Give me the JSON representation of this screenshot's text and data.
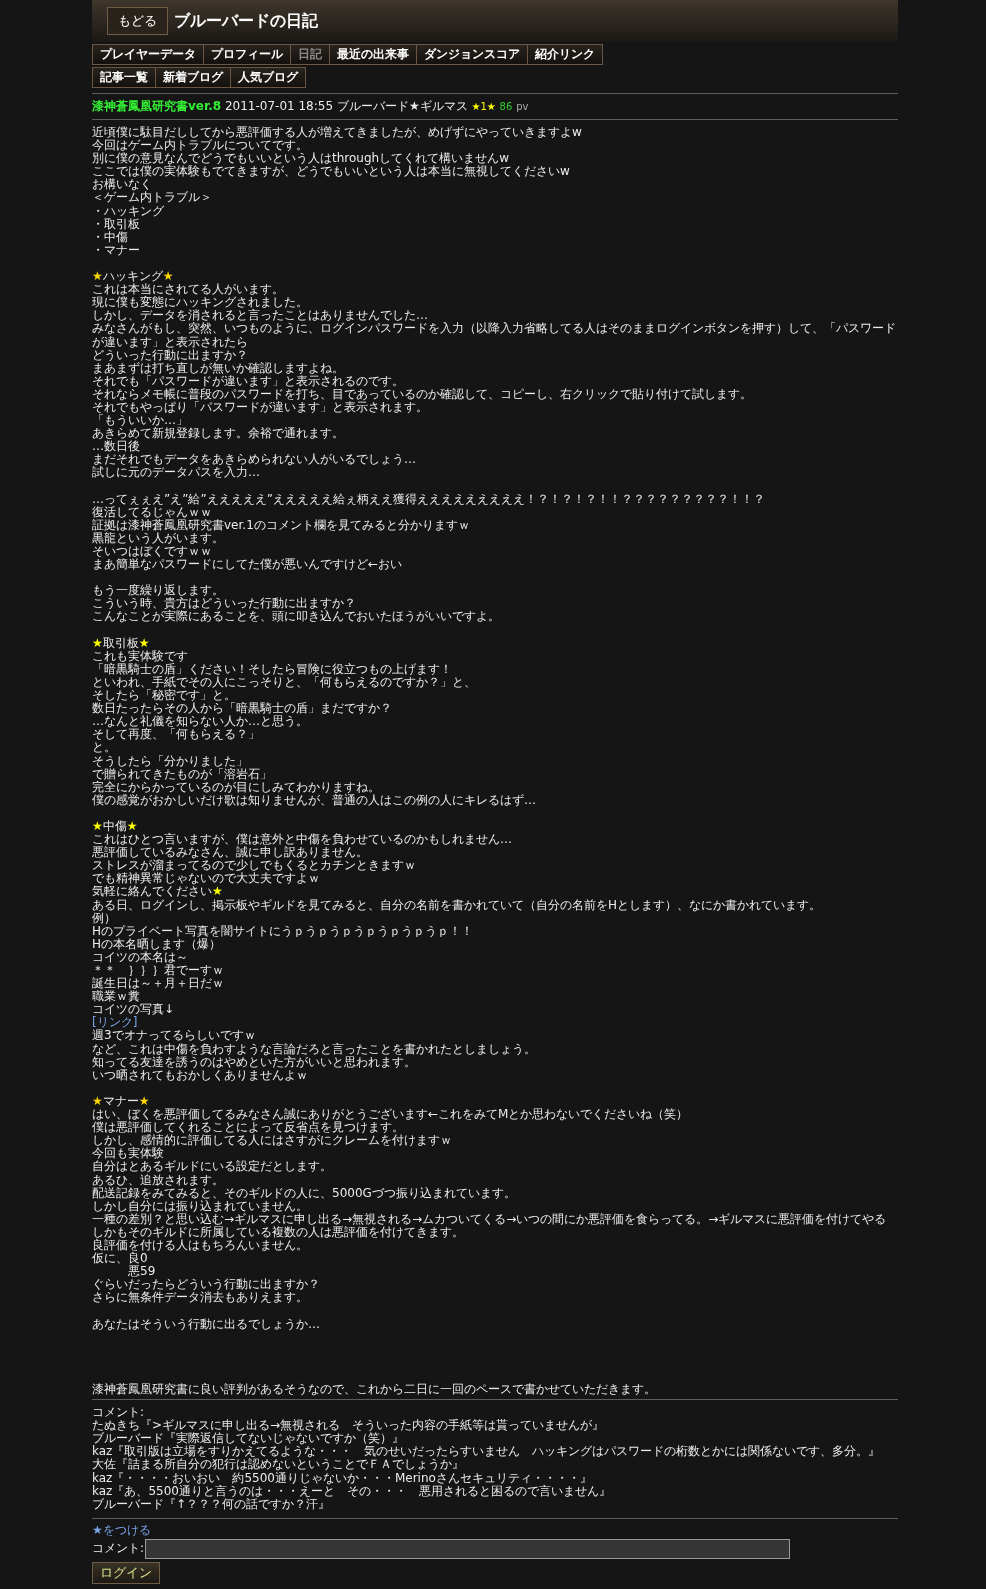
{
  "header": {
    "back_button": "もどる",
    "title": "ブルーバードの日記"
  },
  "tab_rows": [
    {
      "tabs": [
        {
          "label": "プレイヤーデータ",
          "selected": false
        },
        {
          "label": "プロフィール",
          "selected": false
        },
        {
          "label": "日記",
          "selected": true
        },
        {
          "label": "最近の出来事",
          "selected": false
        },
        {
          "label": "ダンジョンスコア",
          "selected": false
        },
        {
          "label": "紹介リンク",
          "selected": false
        }
      ]
    },
    {
      "tabs": [
        {
          "label": "記事一覧",
          "selected": false
        },
        {
          "label": "新着ブログ",
          "selected": false
        },
        {
          "label": "人気ブログ",
          "selected": false
        }
      ]
    }
  ],
  "entry": {
    "title": "漆神蒼鳳凰研究書ver.8",
    "date": "2011-07-01 18:55",
    "author": "ブルーバード★ギルマス",
    "rating": "★1★",
    "views": "86",
    "views_unit": "pv"
  },
  "article": {
    "lines": [
      {
        "text": "近頃僕に駄目だししてから悪評価する人が増えてきましたが、めげずにやっていきますよw"
      },
      {
        "text": "今回はゲーム内トラブルについてです。"
      },
      {
        "text": "別に僕の意見なんでどうでもいいという人はthroughしてくれて構いませんw"
      },
      {
        "text": "ここでは僕の実体験もでてきますが、どうでもいいという人は本当に無視してくださいw"
      },
      {
        "text": "お構いなく"
      },
      {
        "text": "＜ゲーム内トラブル＞"
      },
      {
        "text": "・ハッキング"
      },
      {
        "text": "・取引板"
      },
      {
        "text": "・中傷"
      },
      {
        "text": "・マナー"
      },
      {
        "kind": "blank"
      },
      {
        "parts": [
          {
            "text": "★",
            "color": "#ffd700"
          },
          {
            "text": "ハッキング"
          },
          {
            "text": "★",
            "color": "#ffd700"
          }
        ]
      },
      {
        "text": "これは本当にされてる人がいます。"
      },
      {
        "text": "現に僕も変態にハッキングされました。"
      },
      {
        "text": "しかし、データを消されると言ったことはありませんでした…"
      },
      {
        "text": "みなさんがもし、突然、いつものように、ログインパスワードを入力（以降入力省略してる人はそのままログインボタンを押す）して、「パスワードが違います」と表示されたら"
      },
      {
        "text": "どういった行動に出ますか？"
      },
      {
        "text": "まあまずは打ち直しが無いか確認しますよね。"
      },
      {
        "text": "それでも「パスワードが違います」と表示されるのです。"
      },
      {
        "text": "それならメモ帳に普段のパスワードを打ち、目であっているのか確認して、コピーし、右クリックで貼り付けて試します。"
      },
      {
        "text": "それでもやっぱり「パスワードが違います」と表示されます。"
      },
      {
        "text": "「もういいか…」"
      },
      {
        "text": "あきらめて新規登録します。余裕で通れます。"
      },
      {
        "text": "…数日後"
      },
      {
        "text": "まだそれでもデータをあきらめられない人がいるでしょう…"
      },
      {
        "text": "試しに元のデータパスを入力…"
      },
      {
        "kind": "blank"
      },
      {
        "text": "…ってぇぇえ”え”給”えええええ”えええええ給ぇ柄ええ獲得えええええええええ！？！？！？！！？？？？？？？？？！！？"
      },
      {
        "text": "復活してるじゃんｗｗ"
      },
      {
        "text": "証拠は漆神蒼鳳凰研究書ver.1のコメント欄を見てみると分かりますｗ"
      },
      {
        "text": "黒龍という人がいます。"
      },
      {
        "text": "そいつはぼくですｗｗ"
      },
      {
        "text": "まあ簡単なパスワードにしてた僕が悪いんですけど←おい"
      },
      {
        "kind": "blank"
      },
      {
        "text": "もう一度繰り返します。"
      },
      {
        "text": "こういう時、貴方はどういった行動に出ますか？"
      },
      {
        "text": "こんなことが実際にあることを、頭に叩き込んでおいたほうがいいですよ。"
      },
      {
        "kind": "blank"
      },
      {
        "parts": [
          {
            "text": "★",
            "color": "#ffff00"
          },
          {
            "text": "取引板"
          },
          {
            "text": "★",
            "color": "#ffff00"
          }
        ]
      },
      {
        "text": "これも実体験です"
      },
      {
        "text": "「暗黒騎士の盾」ください！そしたら冒険に役立つもの上げます！"
      },
      {
        "text": "といわれ、手紙でその人にこっそりと、「何もらえるのですか？」と、"
      },
      {
        "text": "そしたら「秘密です」と。"
      },
      {
        "text": "数日たったらその人から「暗黒騎士の盾」まだですか？"
      },
      {
        "text": "…なんと礼儀を知らない人か…と思う。"
      },
      {
        "text": "そして再度、「何もらえる？」"
      },
      {
        "text": "と。"
      },
      {
        "text": "そうしたら「分かりました」"
      },
      {
        "text": "で贈られてきたものが「溶岩石」"
      },
      {
        "text": "完全にからかっているのが目にしみてわかりますね。"
      },
      {
        "text": "僕の感覚がおかしいだけ歌は知りませんが、普通の人はこの例の人にキレるはず…"
      },
      {
        "kind": "blank"
      },
      {
        "parts": [
          {
            "text": "★",
            "color": "#ffff00"
          },
          {
            "text": "中傷"
          },
          {
            "text": "★",
            "color": "#ffff00"
          }
        ]
      },
      {
        "text": "これはひとつ言いますが、僕は意外と中傷を負わせているのかもしれません…"
      },
      {
        "text": "悪評価しているみなさん、誠に申し訳ありません。"
      },
      {
        "text": "ストレスが溜まってるので少しでもくるとカチンときますｗ"
      },
      {
        "text": "でも精神異常じゃないので大丈夫ですよｗ"
      },
      {
        "parts": [
          {
            "text": "気軽に絡んでください"
          },
          {
            "text": "★",
            "color": "#ffff00"
          }
        ]
      },
      {
        "text": "ある日、ログインし、掲示板やギルドを見てみると、自分の名前を書かれていて（自分の名前をHとします）、なにか書かれています。"
      },
      {
        "text": "例）"
      },
      {
        "text": "Hのプライベート写真を闇サイトにうｐうｐうｐうｐうｐうｐうｐ！！"
      },
      {
        "text": "Hの本名晒します（爆）"
      },
      {
        "text": "コイツの本名は～"
      },
      {
        "text": "＊＊　｝｝｝君でーすｗ"
      },
      {
        "text": "誕生日は～＋月＋日だｗ"
      },
      {
        "text": "職業ｗ糞"
      },
      {
        "text": "コイツの写真↓"
      },
      {
        "kind": "link",
        "text": "[リンク]"
      },
      {
        "text": "週3でオナってるらしいですｗ"
      },
      {
        "text": "など、これは中傷を負わすような言論だろと言ったことを書かれたとしましょう。"
      },
      {
        "text": "知ってる友達を誘うのはやめといた方がいいと思われます。"
      },
      {
        "text": "いつ晒されてもおかしくありませんよｗ"
      },
      {
        "kind": "blank"
      },
      {
        "parts": [
          {
            "text": "★",
            "color": "#ffd700"
          },
          {
            "text": "マナー"
          },
          {
            "text": "★",
            "color": "#ffd700"
          }
        ]
      },
      {
        "text": "はい、ぼくを悪評価してるみなさん誠にありがとうございます←これをみてMとか思わないでくださいね（笑）"
      },
      {
        "text": "僕は悪評価してくれることによって反省点を見つけます。"
      },
      {
        "text": "しかし、感情的に評価してる人にはさすがにクレームを付けますｗ"
      },
      {
        "text": "今回も実体験"
      },
      {
        "text": "自分はとあるギルドにいる設定だとします。"
      },
      {
        "text": "あるひ、追放されます。"
      },
      {
        "text": "配送記録をみてみると、そのギルドの人に、5000Gづつ振り込まれています。"
      },
      {
        "text": "しかし自分には振り込まれていません。"
      },
      {
        "text": "一種の差別？と思い込む→ギルマスに申し出る→無視される→ムカついてくる→いつの間にか悪評価を食らってる。→ギルマスに悪評価を付けてやる"
      },
      {
        "text": "しかもそのギルドに所属している複数の人は悪評価を付けてきます。"
      },
      {
        "text": "良評価を付ける人はもちろんいません。"
      },
      {
        "text": "仮に、良0"
      },
      {
        "text": "　　　悪59"
      },
      {
        "text": "ぐらいだったらどういう行動に出ますか？"
      },
      {
        "text": "さらに無条件データ消去もありえます。"
      },
      {
        "kind": "blank"
      },
      {
        "text": "あなたはそういう行動に出るでしょうか…"
      },
      {
        "kind": "blank"
      },
      {
        "kind": "blank"
      },
      {
        "kind": "blank"
      },
      {
        "kind": "blank"
      },
      {
        "text": "漆神蒼鳳凰研究書に良い評判があるそうなので、これから二日に一回のペースで書かせていただきます。"
      }
    ]
  },
  "comments": {
    "label": "コメント:",
    "items": [
      {
        "text": "たぬきち『>ギルマスに申し出る→無視される　そういった内容の手紙等は貰っていませんが』"
      },
      {
        "text": "ブルーバード『実際返信してないじゃないですか（笑）』"
      },
      {
        "text": "kaz『取引版は立場をすりかえてるような・・・　気のせいだったらすいません　ハッキングはパスワードの桁数とかには関係ないです、多分。』"
      },
      {
        "text": "大佐『詰まる所自分の犯行は認めないということでＦＡでしょうか』"
      },
      {
        "text": "kaz『・・・・おいおい　約5500通りじゃないか・・・Merinoさんセキュリティ・・・・』"
      },
      {
        "text": "kaz『あ、5500通りと言うのは・・・えーと　その・・・　悪用されると困るので言いません』"
      },
      {
        "text": "ブルーバード『↑？？？何の話ですか？汗』"
      }
    ]
  },
  "add_star_link": "★をつける",
  "comment_form": {
    "label": "コメント:",
    "submit": "ログイン"
  }
}
